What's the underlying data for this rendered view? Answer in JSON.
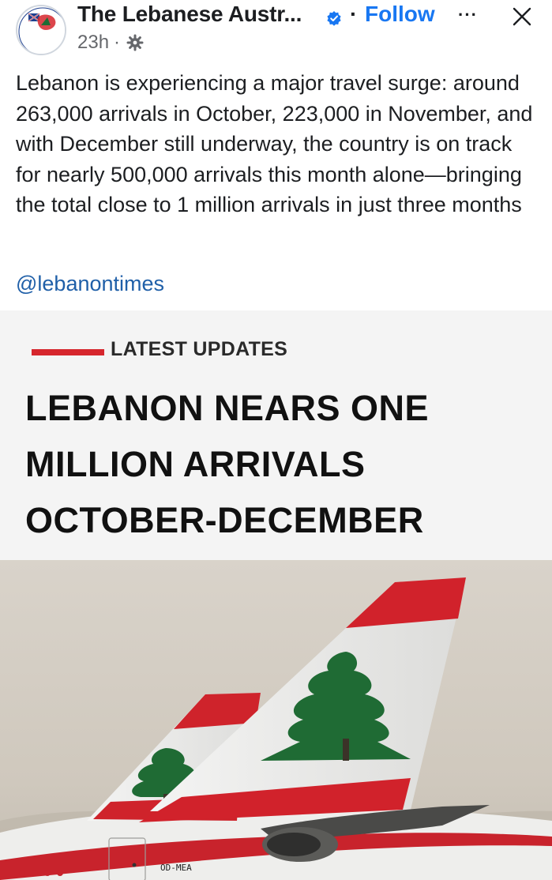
{
  "header": {
    "page_name": "The Lebanese Austr...",
    "separator": "·",
    "follow_label": "Follow",
    "more_label": "···",
    "time": "23h",
    "meta_separator": "·",
    "verified_icon": "verified-badge-icon",
    "privacy_icon": "globe-icon",
    "close_icon": "close-icon",
    "avatar_logo_text": "LEBANESE AUSTRALIAN"
  },
  "post": {
    "text": "Lebanon is experiencing a major travel surge: around 263,000 arrivals in October, 223,000 in November, and with December still underway, the country is on track for nearly 500,000 arrivals this month alone—bringing the total close to 1 million arrivals in just three months",
    "mention": "@lebanontimes"
  },
  "card": {
    "kicker": "LATEST UPDATES",
    "headline_lines": [
      "LEBANON NEARS ONE",
      "MILLION ARRIVALS",
      "OCTOBER-DECEMBER"
    ]
  },
  "photo": {
    "registration": "OD-MEA"
  },
  "colors": {
    "accent_blue": "#1877f2",
    "mention_blue": "#1f5fa8",
    "kicker_red": "#d6262d",
    "cedar_green": "#1f6b34"
  }
}
